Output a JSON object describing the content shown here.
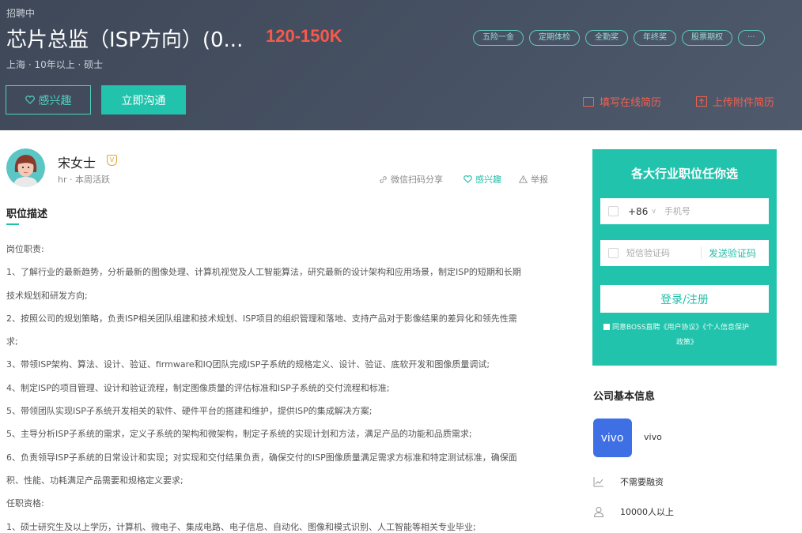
{
  "job": {
    "status": "招聘中",
    "title": "芯片总监（ISP方向）(0...",
    "salary": "120-150K",
    "meta": "上海 · 10年以上 · 硕士",
    "tags": [
      "五险一金",
      "定期体检",
      "全勤奖",
      "年终奖",
      "股票期权",
      "···"
    ],
    "interest_button": "感兴趣",
    "chat_button": "立即沟通",
    "online_resume": "填写在线简历",
    "upload_resume": "上传附件简历"
  },
  "recruiter": {
    "name": "宋女士",
    "verify_badge": "V",
    "meta": "hr · 本周活跃",
    "share": "微信扫码分享",
    "interest": "感兴趣",
    "report": "举报"
  },
  "description": {
    "title": "职位描述",
    "lines": [
      "岗位职责:",
      "1、了解行业的最新趋势，分析最新的图像处理、计算机视觉及人工智能算法，研究最新的设计架构和应用场景，制定ISP的短期和长期",
      "技术规划和研发方向;",
      "2、按照公司的规划策略，负责ISP相关团队组建和技术规划、ISP项目的组织管理和落地、支持产品对于影像结果的差异化和领先性需",
      "求;",
      "3、带领ISP架构、算法、设计、验证、firmware和IQ团队完成ISP子系统的规格定义、设计、验证、底软开发和图像质量调试;",
      "4、制定ISP的项目管理、设计和验证流程，制定图像质量的评估标准和ISP子系统的交付流程和标准;",
      "5、带领团队实现ISP子系统开发相关的软件、硬件平台的搭建和维护，提供ISP的集成解决方案;",
      "5、主导分析ISP子系统的需求，定义子系统的架构和微架构，制定子系统的实现计划和方法，满足产品的功能和品质需求;",
      "6、负责领导ISP子系统的日常设计和实现；对实现和交付结果负责，确保交付的ISP图像质量满足需求方标准和特定测试标准，确保面",
      "积、性能、功耗满足产品需要和规格定义要求;",
      "任职资格:",
      "1、硕士研究生及以上学历，计算机、微电子、集成电路、电子信息、自动化、图像和模式识别、人工智能等相关专业毕业;"
    ]
  },
  "login": {
    "heading": "各大行业职位任你选",
    "country_code": "+86",
    "phone_placeholder": "手机号",
    "sms_placeholder": "短信验证码",
    "send_code": "发送验证码",
    "submit": "登录/注册",
    "agreement_line1": "同意BOSS直聘《用户协议》《个人信息保护",
    "agreement_line2": "政策》"
  },
  "company": {
    "section_title": "公司基本信息",
    "logo_text": "vivo",
    "name": "vivo",
    "financing": "不需要融资",
    "size": "10000人以上"
  },
  "colors": {
    "header_bg": "#414b5a",
    "accent": "#22c3ac",
    "salary": "#f75a4b",
    "resume_link": "#f0624f",
    "vivo_logo": "#3f6fe4"
  }
}
